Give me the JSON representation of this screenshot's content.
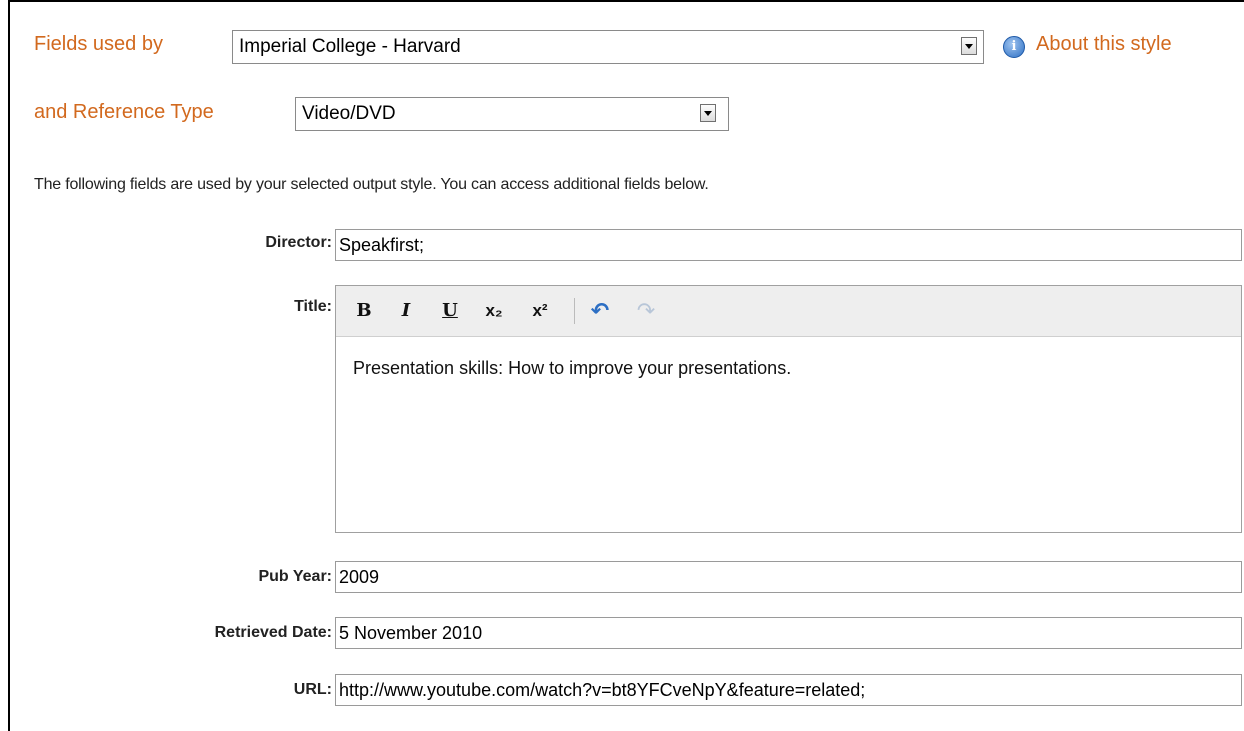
{
  "header": {
    "fields_used_by_label": "Fields used by",
    "style_select_value": "Imperial College - Harvard",
    "about_link": "About this style",
    "info_icon_glyph": "i",
    "ref_type_label": "and Reference Type",
    "ref_type_select_value": "Video/DVD"
  },
  "intro_text": "The following fields are used by your selected output style. You can access additional fields below.",
  "fields": {
    "director": {
      "label": "Director:",
      "value": "Speakfirst;"
    },
    "title": {
      "label": "Title:",
      "value": "Presentation skills: How to improve your presentations."
    },
    "pub_year": {
      "label": "Pub Year:",
      "value": "2009"
    },
    "retrieved_date": {
      "label": "Retrieved Date:",
      "value": "5 November 2010"
    },
    "url": {
      "label": "URL:",
      "value": "http://www.youtube.com/watch?v=bt8YFCveNpY&feature=related;"
    }
  },
  "toolbar": {
    "bold": "B",
    "italic": "I",
    "underline": "U",
    "subscript": "x₂",
    "superscript": "x²",
    "undo": "↶",
    "redo": "↷"
  },
  "colors": {
    "accent_orange": "#d2691e",
    "undo_blue": "#2d6fc4",
    "redo_disabled": "#b8c6d8"
  }
}
